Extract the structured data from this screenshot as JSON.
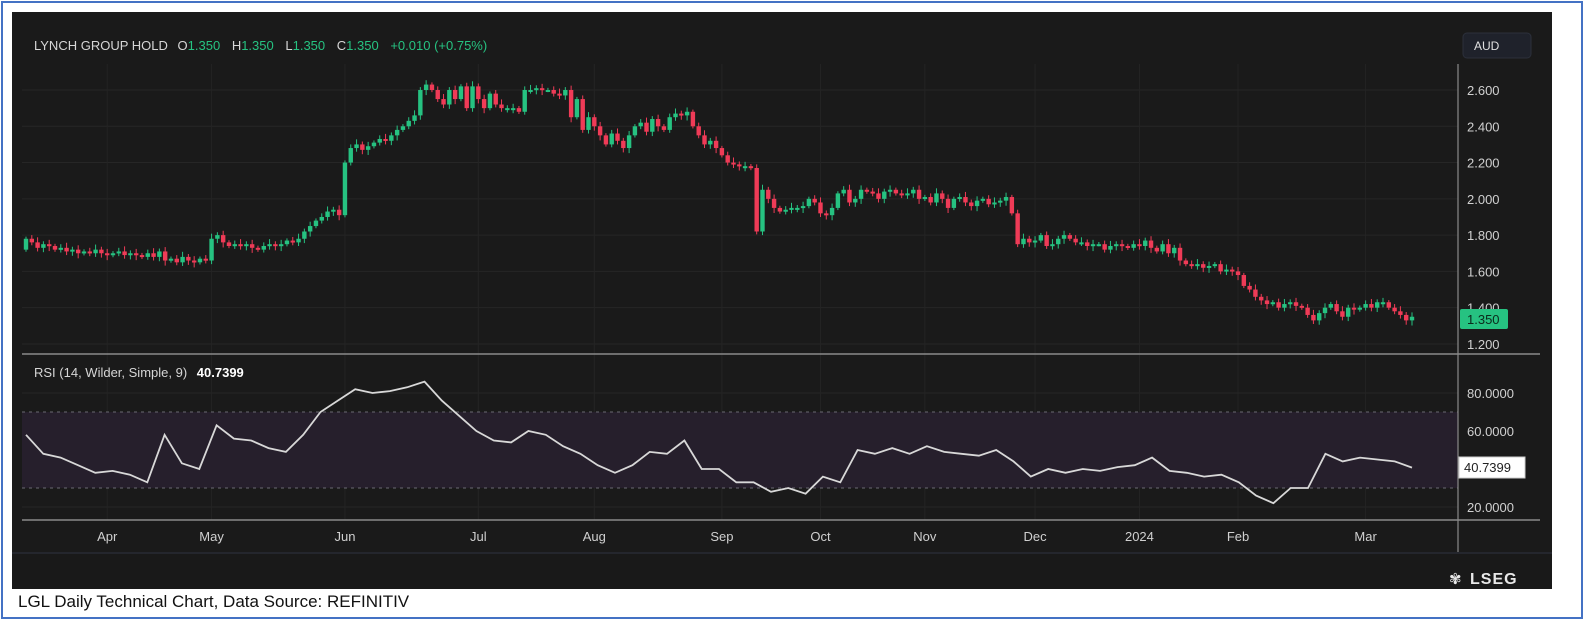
{
  "header": {
    "name": "LYNCH GROUP HOLD",
    "o_label": "O",
    "o": "1.350",
    "h_label": "H",
    "h": "1.350",
    "l_label": "L",
    "l": "1.350",
    "c_label": "C",
    "c": "1.350",
    "change": "+0.010 (+0.75%)"
  },
  "currency": "AUD",
  "last_price_tag": "1.350",
  "rsi_label": "RSI (14, Wilder, Simple, 9)",
  "rsi_value": "40.7399",
  "brand": "LSEG",
  "caption": "LGL Daily Technical Chart, Data Source: REFINITIV",
  "colors": {
    "up": "#26c281",
    "down": "#ef3b57",
    "rsi_line": "#d8d8d8",
    "rsi_band": "#2a2230",
    "frame": "#4472c4"
  },
  "chart_data": [
    {
      "type": "candlestick",
      "title": "LYNCH GROUP HOLD",
      "ylabel": "AUD",
      "ylim": [
        1.15,
        2.75
      ],
      "y_ticks": [
        "2.600",
        "2.400",
        "2.200",
        "2.000",
        "1.800",
        "1.600",
        "1.400",
        "1.200"
      ],
      "y_tick_values": [
        2.6,
        2.4,
        2.2,
        2.0,
        1.8,
        1.6,
        1.4,
        1.2
      ],
      "x_ticks": [
        "Apr",
        "May",
        "Jun",
        "Jul",
        "Aug",
        "Sep",
        "Oct",
        "Nov",
        "Dec",
        "2024",
        "Feb",
        "Mar"
      ],
      "x_tick_bar_index": [
        14,
        32,
        55,
        78,
        98,
        120,
        137,
        155,
        174,
        192,
        209,
        231
      ],
      "first_open": 1.72,
      "close": [
        1.78,
        1.76,
        1.73,
        1.75,
        1.74,
        1.72,
        1.73,
        1.71,
        1.72,
        1.7,
        1.71,
        1.7,
        1.72,
        1.7,
        1.69,
        1.7,
        1.71,
        1.69,
        1.7,
        1.69,
        1.68,
        1.7,
        1.68,
        1.71,
        1.66,
        1.67,
        1.65,
        1.68,
        1.66,
        1.65,
        1.67,
        1.66,
        1.78,
        1.8,
        1.76,
        1.74,
        1.75,
        1.74,
        1.75,
        1.73,
        1.72,
        1.74,
        1.75,
        1.74,
        1.75,
        1.77,
        1.76,
        1.78,
        1.82,
        1.85,
        1.88,
        1.9,
        1.93,
        1.94,
        1.91,
        2.2,
        2.28,
        2.3,
        2.27,
        2.29,
        2.31,
        2.33,
        2.32,
        2.35,
        2.38,
        2.4,
        2.43,
        2.46,
        2.6,
        2.63,
        2.6,
        2.55,
        2.52,
        2.6,
        2.55,
        2.62,
        2.5,
        2.62,
        2.55,
        2.5,
        2.58,
        2.52,
        2.5,
        2.5,
        2.5,
        2.48,
        2.6,
        2.6,
        2.61,
        2.6,
        2.6,
        2.58,
        2.57,
        2.6,
        2.45,
        2.55,
        2.38,
        2.45,
        2.4,
        2.35,
        2.3,
        2.36,
        2.32,
        2.28,
        2.35,
        2.4,
        2.42,
        2.37,
        2.44,
        2.4,
        2.38,
        2.45,
        2.47,
        2.46,
        2.48,
        2.4,
        2.35,
        2.3,
        2.32,
        2.28,
        2.24,
        2.2,
        2.19,
        2.18,
        2.18,
        2.17,
        1.82,
        2.05,
        2.0,
        1.95,
        1.93,
        1.94,
        1.95,
        1.95,
        1.96,
        2.0,
        1.98,
        1.92,
        1.91,
        1.95,
        2.03,
        2.05,
        1.98,
        2.0,
        2.05,
        2.04,
        2.03,
        2.0,
        2.04,
        2.05,
        2.03,
        2.02,
        2.03,
        2.05,
        2.0,
        2.01,
        1.98,
        2.03,
        2.0,
        1.95,
        2.0,
        2.01,
        1.98,
        1.96,
        1.99,
        2.0,
        1.97,
        1.98,
        1.99,
        2.01,
        1.92,
        1.75,
        1.78,
        1.76,
        1.77,
        1.8,
        1.74,
        1.75,
        1.78,
        1.8,
        1.78,
        1.76,
        1.76,
        1.74,
        1.75,
        1.75,
        1.72,
        1.74,
        1.75,
        1.74,
        1.73,
        1.75,
        1.74,
        1.77,
        1.73,
        1.71,
        1.75,
        1.7,
        1.73,
        1.66,
        1.64,
        1.63,
        1.64,
        1.62,
        1.63,
        1.64,
        1.6,
        1.61,
        1.6,
        1.58,
        1.52,
        1.5,
        1.46,
        1.44,
        1.42,
        1.43,
        1.4,
        1.42,
        1.43,
        1.41,
        1.4,
        1.36,
        1.33,
        1.37,
        1.4,
        1.42,
        1.38,
        1.35,
        1.4,
        1.39,
        1.4,
        1.42,
        1.4,
        1.43,
        1.43,
        1.4,
        1.38,
        1.36,
        1.33,
        1.35
      ]
    },
    {
      "type": "line",
      "title": "RSI (14, Wilder, Simple, 9)",
      "ylim": [
        12,
        94
      ],
      "y_ticks": [
        "80.0000",
        "60.0000",
        "20.0000"
      ],
      "y_tick_values": [
        80,
        60,
        20
      ],
      "bands": [
        30,
        70
      ],
      "values": [
        58,
        48,
        46,
        42,
        38,
        39,
        37,
        33,
        58,
        43,
        40,
        63,
        56,
        55,
        51,
        49,
        58,
        70,
        76,
        82,
        80,
        81,
        83,
        86,
        76,
        68,
        60,
        55,
        54,
        60,
        58,
        52,
        48,
        42,
        38,
        42,
        49,
        48,
        55,
        40,
        40,
        33,
        33,
        28,
        30,
        27,
        36,
        33,
        50,
        48,
        51,
        48,
        52,
        49,
        48,
        47,
        50,
        44,
        36,
        40,
        38,
        40,
        39,
        41,
        42,
        46,
        39,
        38,
        36,
        37,
        33,
        26,
        22,
        30,
        30,
        48,
        44,
        46,
        45,
        44,
        40.74
      ]
    }
  ]
}
